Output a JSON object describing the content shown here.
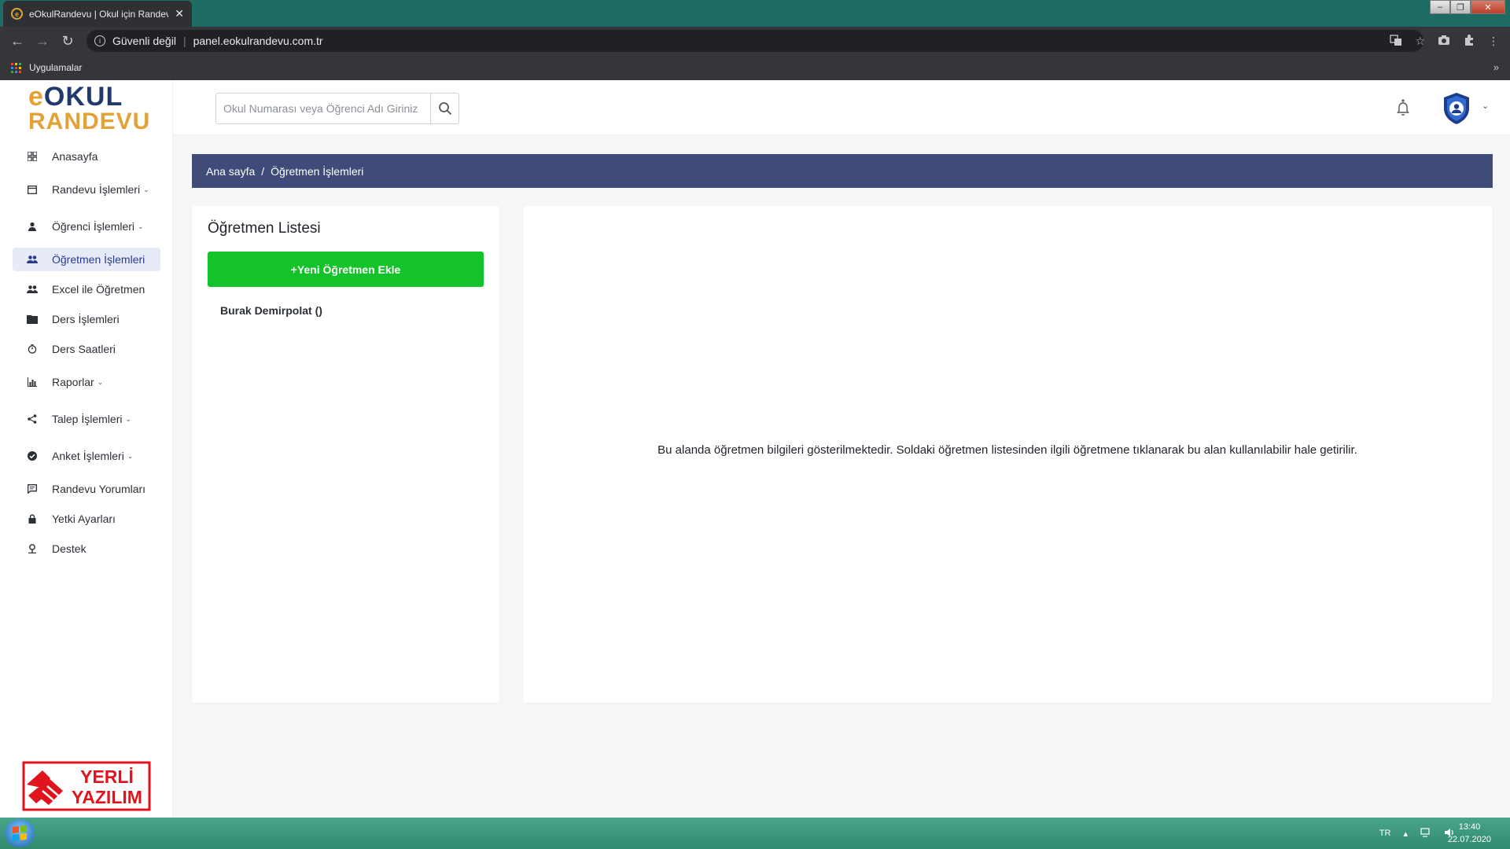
{
  "browser": {
    "tab_title": "eOkulRandevu | Okul için Randevu",
    "address": "panel.eokulrandevu.com.tr",
    "security_label": "Güvenli değil",
    "bookmarks_label": "Uygulamalar",
    "bookmarks_more": "»"
  },
  "logo": {
    "prefix": "e",
    "top": "OKUL",
    "bottom": "RANDEVU"
  },
  "header": {
    "search_placeholder": "Okul Numarası veya Öğrenci Adı Giriniz"
  },
  "sidebar": {
    "items": [
      {
        "label": "Anasayfa",
        "icon": "dashboard-icon",
        "chevron": ""
      },
      {
        "label": "Randevu İşlemleri",
        "icon": "calendar-icon",
        "chevron": "⌄"
      },
      {
        "label": "Öğrenci İşlemleri",
        "icon": "person-icon",
        "chevron": "⌄"
      },
      {
        "label": "Öğretmen İşlemleri",
        "icon": "people-icon",
        "chevron": ""
      },
      {
        "label": "Excel ile Öğretmen",
        "icon": "people-icon",
        "chevron": ""
      },
      {
        "label": "Ders İşlemleri",
        "icon": "book-icon",
        "chevron": ""
      },
      {
        "label": "Ders Saatleri",
        "icon": "clock-icon",
        "chevron": ""
      },
      {
        "label": "Raporlar",
        "icon": "bar-chart-icon",
        "chevron": "⌄"
      },
      {
        "label": "Talep İşlemleri",
        "icon": "share-icon",
        "chevron": "⌄"
      },
      {
        "label": "Anket İşlemleri",
        "icon": "check-circle-icon",
        "chevron": "⌄"
      },
      {
        "label": "Randevu Yorumları",
        "icon": "comment-icon",
        "chevron": ""
      },
      {
        "label": "Yetki Ayarları",
        "icon": "lock-icon",
        "chevron": ""
      },
      {
        "label": "Destek",
        "icon": "support-icon",
        "chevron": ""
      }
    ],
    "active_index": 3,
    "badge_line1": "YERLİ",
    "badge_line2": "YAZILIM"
  },
  "breadcrumb": {
    "home": "Ana sayfa",
    "separator": "/",
    "current": "Öğretmen İşlemleri"
  },
  "teacher_list": {
    "title": "Öğretmen Listesi",
    "add_button": "+Yeni Öğretmen Ekle",
    "teachers": [
      "Burak Demirpolat ()"
    ]
  },
  "detail": {
    "info_text": "Bu alanda öğretmen bilgileri gösterilmektedir. Soldaki öğretmen listesinden ilgili öğretmene tıklanarak bu alan kullanılabilir hale getirilir."
  },
  "taskbar": {
    "lang": "TR",
    "time": "13:40",
    "date": "22.07.2020"
  },
  "colors": {
    "breadcrumb_bg": "#3f4b78",
    "add_button_bg": "#14c22a",
    "active_nav_bg": "#e6ebf7",
    "logo_orange": "#e3a237",
    "logo_navy": "#1f3a6b"
  }
}
